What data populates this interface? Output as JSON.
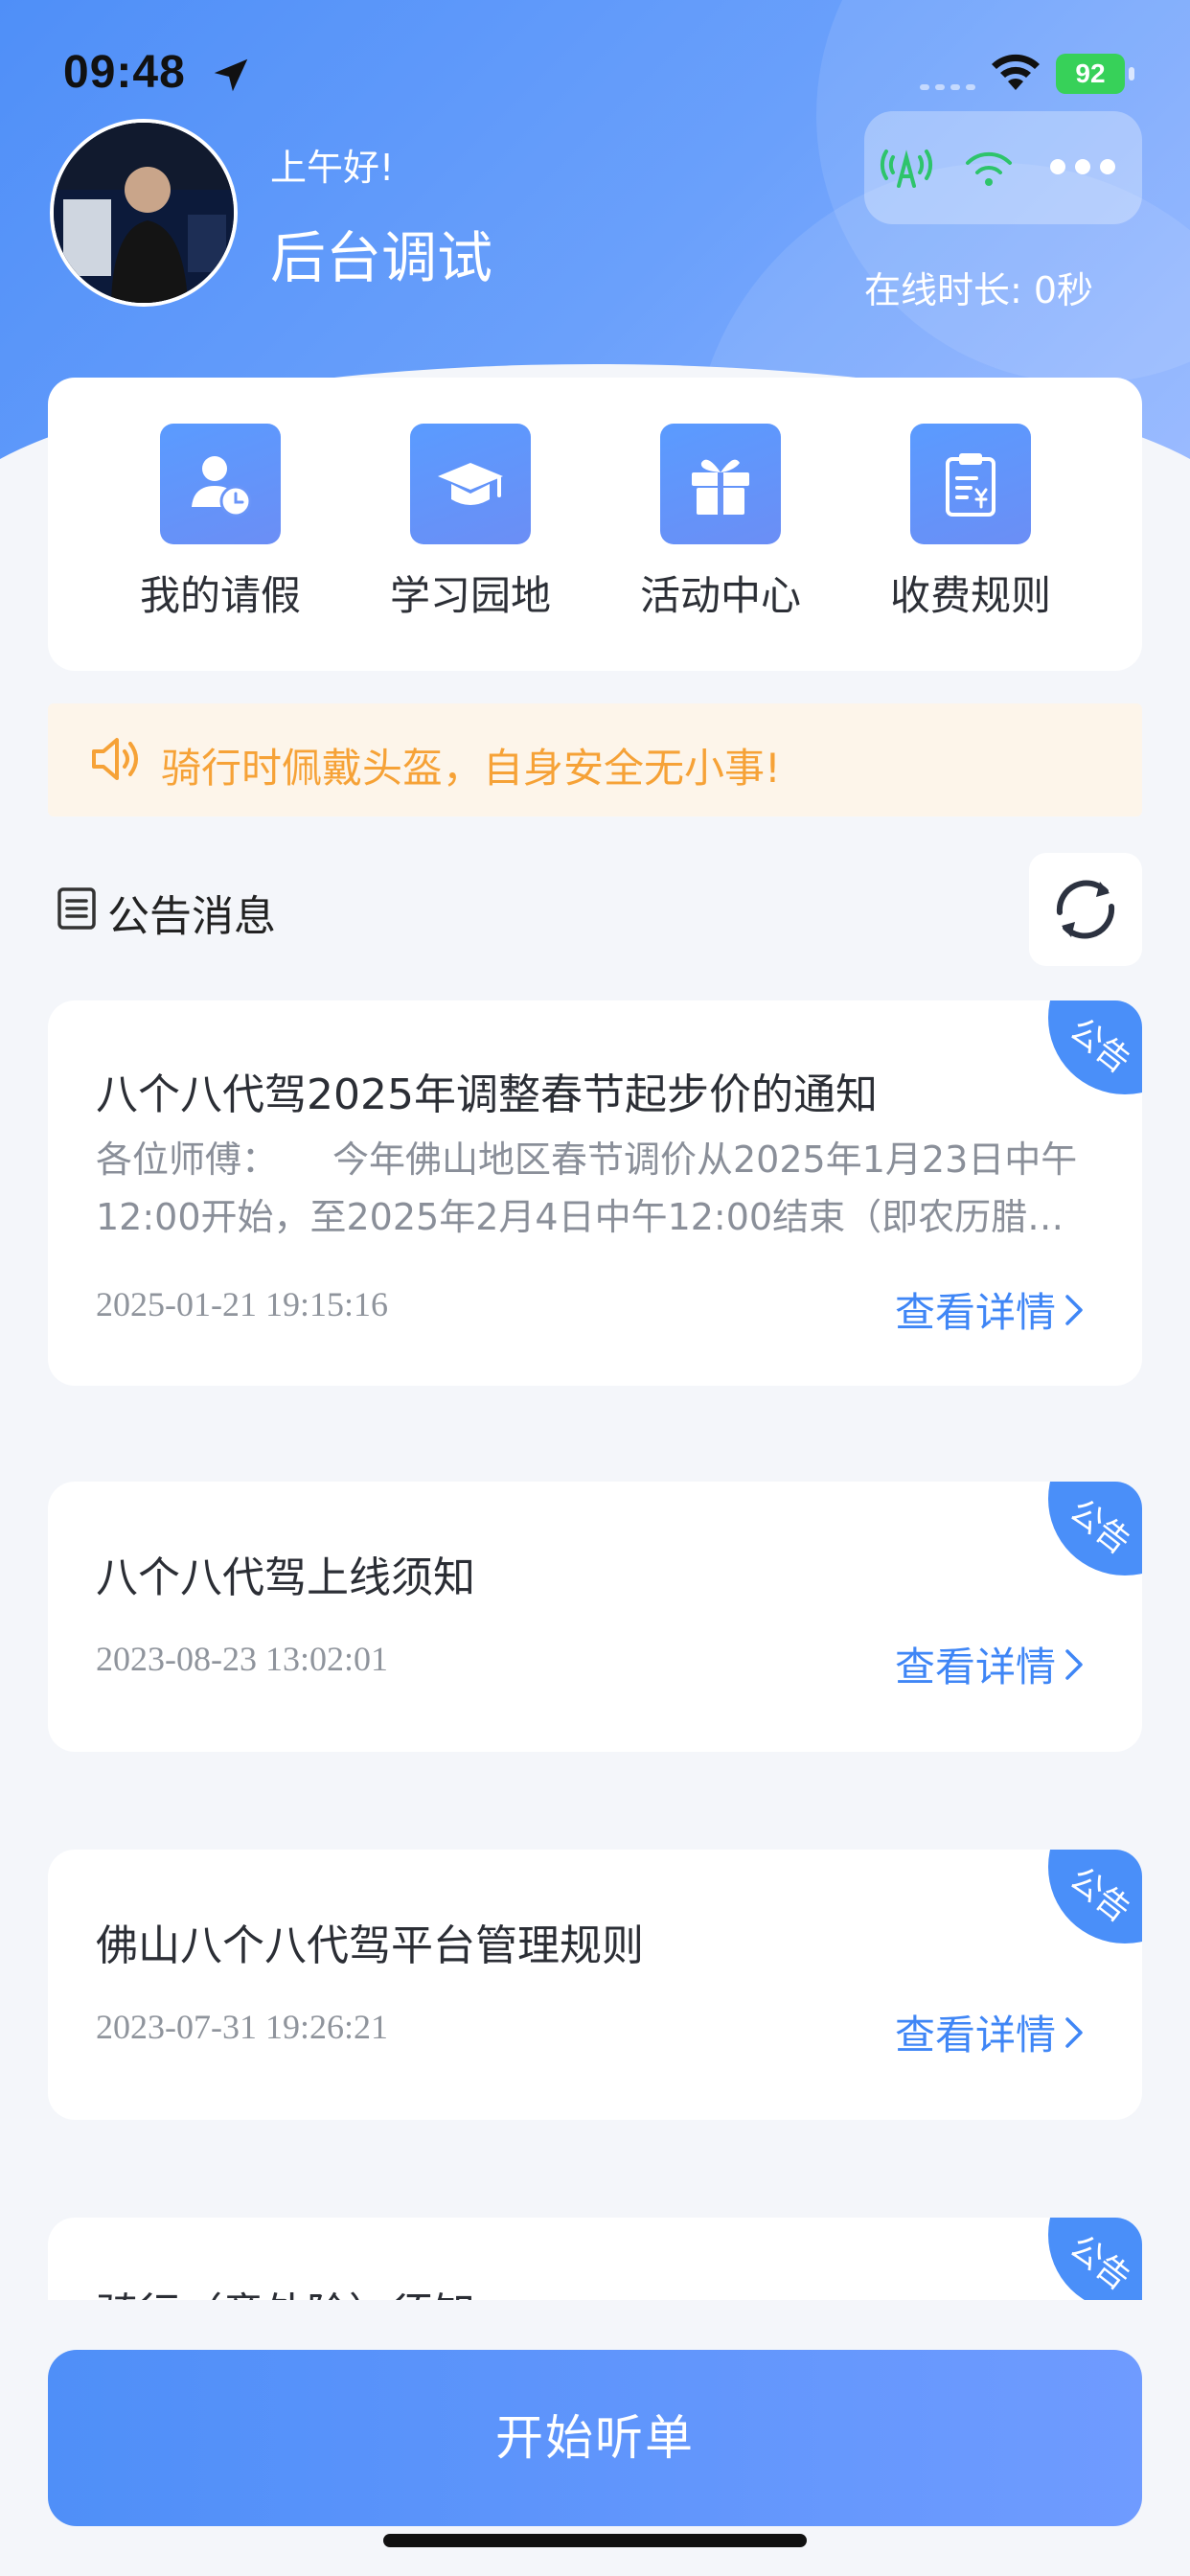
{
  "status_bar": {
    "time": "09:48",
    "battery": "92"
  },
  "profile": {
    "greeting": "上午好!",
    "name": "后台调试",
    "online_time": "在线时长: 0秒"
  },
  "menu": {
    "items": [
      {
        "label": "我的请假",
        "icon": "person-clock-icon"
      },
      {
        "label": "学习园地",
        "icon": "graduation-cap-icon"
      },
      {
        "label": "活动中心",
        "icon": "gift-icon"
      },
      {
        "label": "收费规则",
        "icon": "clipboard-yen-icon"
      }
    ]
  },
  "notice": {
    "text": "骑行时佩戴头盔，自身安全无小事!"
  },
  "announcements": {
    "section_title": "公告消息",
    "badge": "公告",
    "link_label": "查看详情",
    "items": [
      {
        "title": "八个八代驾2025年调整春节起步价的通知",
        "desc": "各位师傅：　　今年佛山地区春节调价从2025年1月23日中午12:00开始，至2025年2月4日中午12:00结束（即农历腊…",
        "date": "2025-01-21 19:15:16"
      },
      {
        "title": "八个八代驾上线须知",
        "date": "2023-08-23 13:02:01"
      },
      {
        "title": "佛山八个八代驾平台管理规则",
        "date": "2023-07-31 19:26:21"
      },
      {
        "title": "骑行（意外险）须知"
      }
    ]
  },
  "actions": {
    "start_label": "开始听单"
  },
  "colors": {
    "brand": "#4f8ff8",
    "notice_text": "#f6a237",
    "link": "#3f86f6"
  }
}
